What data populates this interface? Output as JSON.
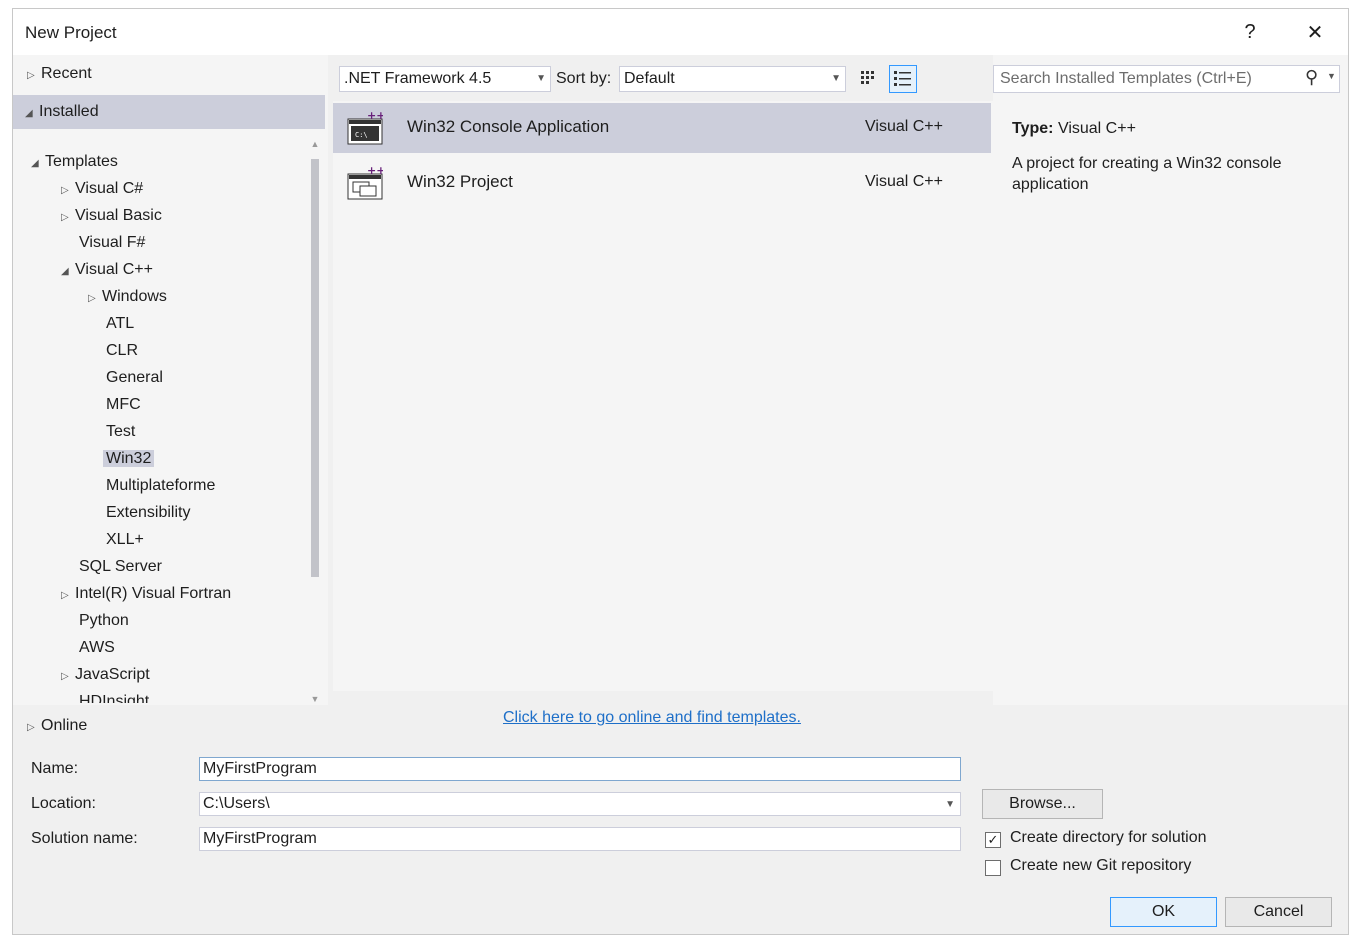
{
  "window": {
    "title": "New Project",
    "help_glyph": "?",
    "close_glyph": "✕"
  },
  "tree": {
    "recent": "Recent",
    "installed": "Installed",
    "templates": "Templates",
    "items": {
      "visual_csharp": "Visual C#",
      "visual_basic": "Visual Basic",
      "visual_fsharp": "Visual F#",
      "visual_cpp": "Visual C++",
      "windows": "Windows",
      "atl": "ATL",
      "clr": "CLR",
      "general": "General",
      "mfc": "MFC",
      "test": "Test",
      "win32": "Win32",
      "multiplateforme": "Multiplateforme",
      "extensibility": "Extensibility",
      "xll": "XLL+",
      "sql_server": "SQL Server",
      "intel_fortran": "Intel(R) Visual Fortran",
      "python": "Python",
      "aws": "AWS",
      "javascript": "JavaScript",
      "hdinsight": "HDInsight"
    },
    "online": "Online"
  },
  "toolbar": {
    "framework": ".NET Framework 4.5",
    "sort_label": "Sort by:",
    "sort_value": "Default"
  },
  "templates": [
    {
      "name": "Win32 Console Application",
      "language": "Visual C++",
      "icon_text": "C:\\"
    },
    {
      "name": "Win32 Project",
      "language": "Visual C++"
    }
  ],
  "online_link": "Click here to go online and find templates.",
  "search": {
    "placeholder": "Search Installed Templates (Ctrl+E)"
  },
  "details": {
    "type_label": "Type:",
    "type_value": "Visual C++",
    "description": "A project for creating a Win32 console application"
  },
  "form": {
    "name_label": "Name:",
    "name_value": "MyFirstProgram",
    "location_label": "Location:",
    "location_value": "C:\\Users\\",
    "solution_label": "Solution name:",
    "solution_value": "MyFirstProgram",
    "browse": "Browse...",
    "create_dir": "Create directory for solution",
    "create_dir_checked": true,
    "create_git": "Create new Git repository",
    "create_git_checked": false,
    "ok": "OK",
    "cancel": "Cancel"
  },
  "colors": {
    "selection": "#cccedb",
    "link": "#1e6fc8",
    "panel": "#f5f5f5"
  }
}
